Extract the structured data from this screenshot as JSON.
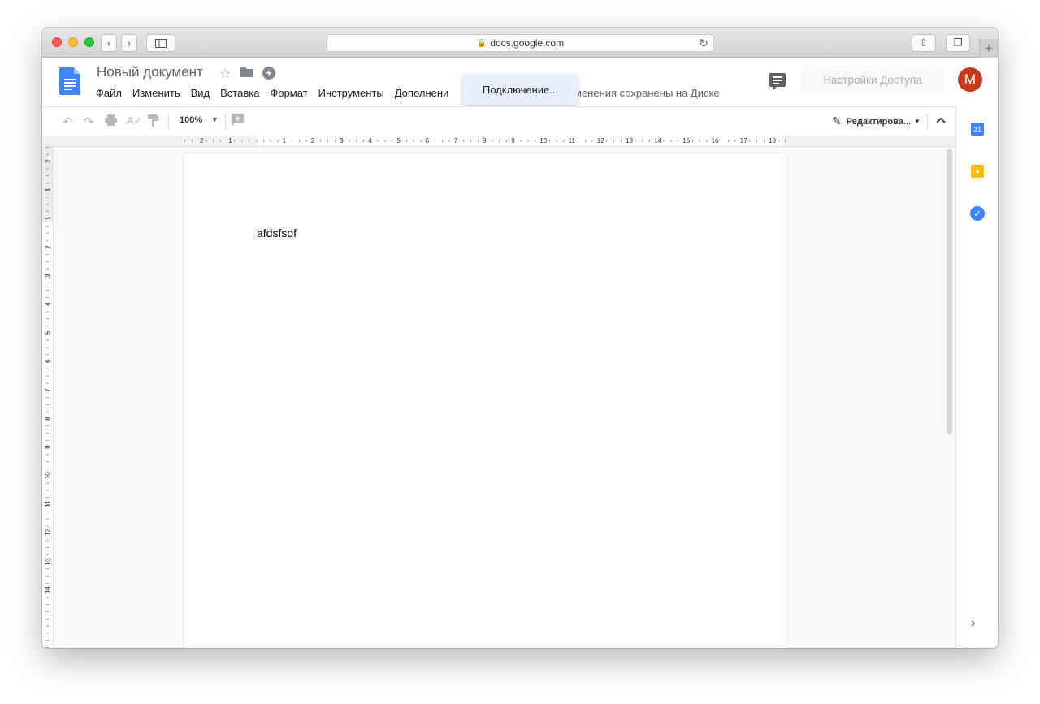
{
  "browser": {
    "url": "docs.google.com",
    "back_icon": "chevron-left-icon",
    "forward_icon": "chevron-right-icon",
    "sidebar_icon": "sidebar-icon",
    "share_icon": "share-icon",
    "tabs_icon": "tabs-overview-icon",
    "new_tab_label": "+"
  },
  "doc": {
    "title": "Новый документ",
    "menu": [
      "Файл",
      "Изменить",
      "Вид",
      "Вставка",
      "Формат",
      "Инструменты",
      "Дополнени"
    ],
    "save_status": "менения сохранены на Диске",
    "share_label": "Настройки Доступа",
    "avatar_letter": "M",
    "body_text": "afdsfsdf"
  },
  "popup": {
    "item": "Подключение..."
  },
  "toolbar": {
    "zoom": "100%",
    "mode_label": "Редактирова..."
  },
  "ruler": {
    "horizontal": [
      "2",
      "1",
      "1",
      "2",
      "3",
      "4",
      "5",
      "6",
      "7",
      "8",
      "9",
      "10",
      "11",
      "12",
      "13",
      "14",
      "15",
      "16",
      "17",
      "18"
    ],
    "vertical": [
      "2",
      "1",
      "1",
      "2",
      "3",
      "4",
      "5",
      "6",
      "7",
      "8",
      "9",
      "10",
      "11",
      "12",
      "13",
      "14"
    ]
  },
  "side_panel": {
    "calendar_label": "31"
  },
  "colors": {
    "docs_blue": "#4285f4",
    "avatar": "#c33b1d",
    "popup_bg": "#e8f0fe",
    "keep_yellow": "#fbbc04"
  }
}
